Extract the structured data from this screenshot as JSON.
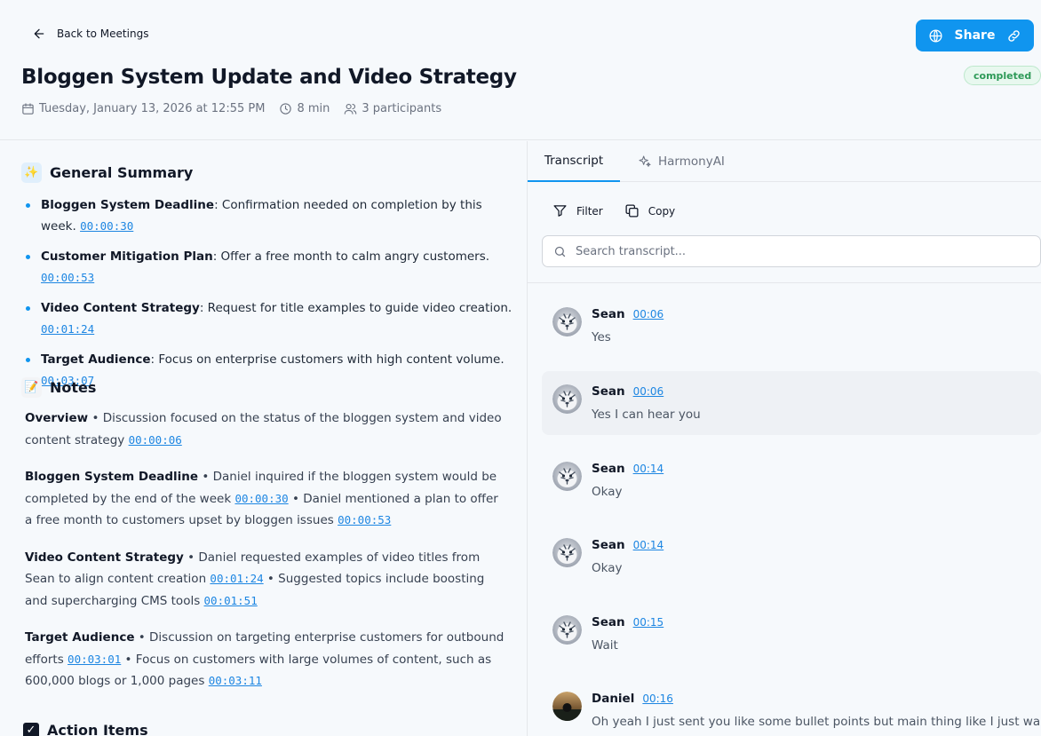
{
  "header": {
    "back_label": "Back to Meetings",
    "title": "Bloggen System Update and Video Strategy",
    "date": "Tuesday, January 13, 2026 at 12:55 PM",
    "duration": "8 min",
    "participants": "3 participants",
    "share_label": "Share",
    "status": "completed"
  },
  "summary": {
    "title": "General Summary",
    "icon": "sparkles-icon",
    "items": [
      {
        "label": "Bloggen System Deadline",
        "text": ": Confirmation needed on completion by this week.",
        "ts": "00:00:30"
      },
      {
        "label": "Customer Mitigation Plan",
        "text": ": Offer a free month to calm angry customers.",
        "ts": "00:00:53"
      },
      {
        "label": "Video Content Strategy",
        "text": ": Request for title examples to guide video creation.",
        "ts": "00:01:24"
      },
      {
        "label": "Target Audience",
        "text": ": Focus on enterprise customers with high content volume.",
        "ts": "00:03:07"
      }
    ]
  },
  "notes": {
    "title": "Notes",
    "icon": "memo-icon",
    "items": [
      {
        "label": "Overview",
        "parts": [
          {
            "text": " • Discussion focused on the status of the bloggen system and video content strategy ",
            "ts": "00:00:06"
          }
        ]
      },
      {
        "label": "Bloggen System Deadline",
        "parts": [
          {
            "text": " • Daniel inquired if the bloggen system would be completed by the end of the week ",
            "ts": "00:00:30"
          },
          {
            "text": " • Daniel mentioned a plan to offer a free month to customers upset by bloggen issues ",
            "ts": "00:00:53"
          }
        ]
      },
      {
        "label": "Video Content Strategy",
        "parts": [
          {
            "text": " • Daniel requested examples of video titles from Sean to align content creation ",
            "ts": "00:01:24"
          },
          {
            "text": " • Suggested topics include boosting and supercharging CMS tools ",
            "ts": "00:01:51"
          }
        ]
      },
      {
        "label": "Target Audience",
        "parts": [
          {
            "text": " • Discussion on targeting enterprise customers for outbound efforts ",
            "ts": "00:03:01"
          },
          {
            "text": " • Focus on customers with large volumes of content, such as 600,000 blogs or 1,000 pages ",
            "ts": "00:03:11"
          }
        ]
      }
    ]
  },
  "action_items": {
    "title": "Action Items"
  },
  "tabs": {
    "transcript": "Transcript",
    "ai": "HarmonyAI"
  },
  "tools": {
    "filter": "Filter",
    "copy": "Copy"
  },
  "search": {
    "placeholder": "Search transcript..."
  },
  "messages": [
    {
      "name": "Sean",
      "time": "00:06",
      "text": "Yes",
      "highlighted": false,
      "avatar": "tiger"
    },
    {
      "name": "Sean",
      "time": "00:06",
      "text": "Yes I can hear you",
      "highlighted": true,
      "avatar": "tiger"
    },
    {
      "name": "Sean",
      "time": "00:14",
      "text": "Okay",
      "highlighted": false,
      "avatar": "tiger"
    },
    {
      "name": "Sean",
      "time": "00:14",
      "text": "Okay",
      "highlighted": false,
      "avatar": "tiger"
    },
    {
      "name": "Sean",
      "time": "00:15",
      "text": "Wait",
      "highlighted": false,
      "avatar": "tiger"
    },
    {
      "name": "Daniel",
      "time": "00:16",
      "text": "Oh yeah I just sent you like some bullet points but main thing like I just wanted",
      "highlighted": false,
      "avatar": "photo"
    }
  ],
  "colors": {
    "accent": "#1095ef",
    "badge_bg": "#e8f8ef",
    "badge_text": "#2e9a58"
  }
}
